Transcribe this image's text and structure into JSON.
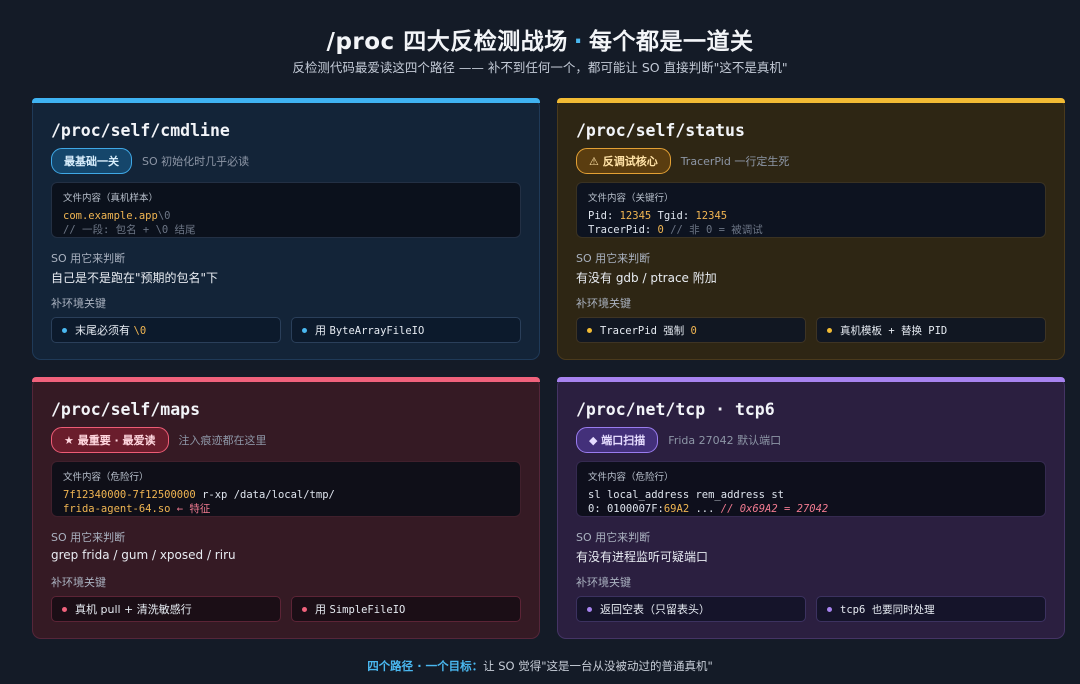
{
  "header": {
    "title_main": "/proc 四大反检测战场",
    "title_dot": "·",
    "title_tail": "每个都是一道关",
    "subtitle": "反检测代码最爱读这四个路径 —— 补不到任何一个，都可能让 SO 直接判断\"这不是真机\""
  },
  "labels": {
    "judge": "SO 用它来判断",
    "keys": "补环境关键"
  },
  "cards": [
    {
      "title": "/proc/self/cmdline",
      "badge": "最基础一关",
      "badge_note": "SO 初始化时几乎必读",
      "code_head": "文件内容（真机样本）",
      "code": {
        "l1_a": "com.example.app",
        "l1_b": "\\0",
        "l2": "// 一段: 包名 + \\0 结尾"
      },
      "judge": "自己是不是跑在\"预期的包名\"下",
      "keys": [
        {
          "a": "末尾必须有 ",
          "b": "\\0"
        },
        {
          "a": "用 ",
          "b": "ByteArrayFileIO"
        }
      ]
    },
    {
      "title": "/proc/self/status",
      "badge": "⚠ 反调试核心",
      "badge_note": "TracerPid 一行定生死",
      "code_head": "文件内容（关键行）",
      "code": {
        "l1_a": "Pid: ",
        "l1_b": "12345",
        "l1_c": " Tgid: ",
        "l1_d": "12345",
        "l2_a": "TracerPid: ",
        "l2_b": "0",
        "l2_c": " // 非 0 = 被调试"
      },
      "judge": "有没有 gdb / ptrace 附加",
      "keys": [
        {
          "a": "TracerPid 强制 ",
          "b": "0"
        },
        {
          "a": "真机模板 + 替换 PID",
          "b": ""
        }
      ]
    },
    {
      "title": "/proc/self/maps",
      "badge": "★ 最重要 · 最爱读",
      "badge_note": "注入痕迹都在这里",
      "code_head": "文件内容（危险行）",
      "code": {
        "l1_a": "7f12340000-7f12500000",
        "l1_b": " r-xp /data/local/tmp/",
        "l2_a": "frida-agent-64.so",
        "l2_b": " ← 特征"
      },
      "judge": "grep frida / gum / xposed / riru",
      "keys": [
        {
          "a": "真机 pull + 清洗敏感行",
          "b": ""
        },
        {
          "a": "用 ",
          "b": "SimpleFileIO"
        }
      ]
    },
    {
      "title": "/proc/net/tcp · tcp6",
      "badge": "◆ 端口扫描",
      "badge_note": "Frida 27042 默认端口",
      "code_head": "文件内容（危险行）",
      "code": {
        "l1": "sl local_address rem_address st",
        "l2_a": "0: 0100007F:",
        "l2_b": "69A2",
        "l2_c": " ... ",
        "l2_d": "// 0x69A2 = 27042"
      },
      "judge": "有没有进程监听可疑端口",
      "keys": [
        {
          "a": "返回空表（只留表头）",
          "b": ""
        },
        {
          "a": "tcp6 也要同时处理",
          "b": ""
        }
      ]
    }
  ],
  "footer": {
    "highlight": "四个路径 · 一个目标：",
    "text": "让 SO 觉得\"这是一台从没被动过的普通真机\""
  },
  "colors": {
    "cmdline_accent": "#3fb3f2",
    "status_accent": "#f2bb34",
    "maps_accent": "#f0627c",
    "tcp_accent": "#a783f0"
  }
}
